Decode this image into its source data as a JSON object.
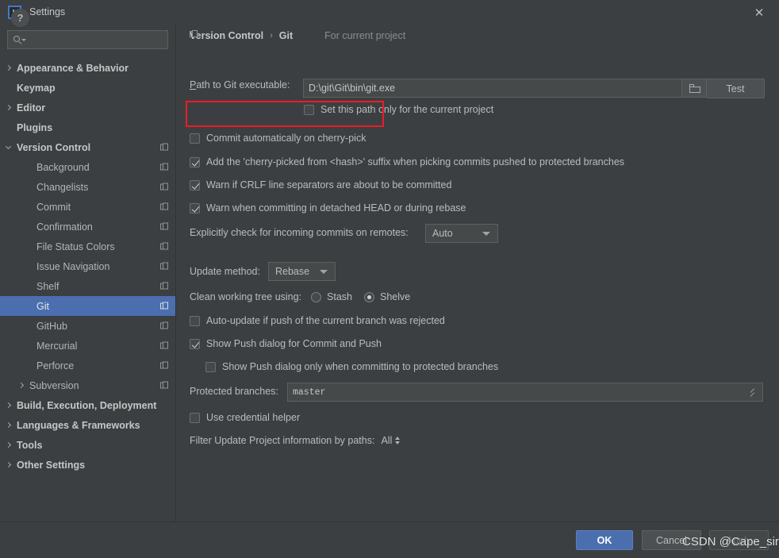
{
  "window": {
    "title": "Settings",
    "logo_text": "IJ",
    "close_label": "✕"
  },
  "sidebar": {
    "search": {
      "value": "",
      "placeholder": ""
    },
    "items": [
      {
        "label": "Appearance & Behavior",
        "indent": 0,
        "arrow": "right",
        "bold": true,
        "module_icon": false,
        "selected": false
      },
      {
        "label": "Keymap",
        "indent": 0,
        "arrow": "none",
        "bold": true,
        "module_icon": false,
        "selected": false
      },
      {
        "label": "Editor",
        "indent": 0,
        "arrow": "right",
        "bold": true,
        "module_icon": false,
        "selected": false
      },
      {
        "label": "Plugins",
        "indent": 0,
        "arrow": "none",
        "bold": true,
        "module_icon": false,
        "selected": false
      },
      {
        "label": "Version Control",
        "indent": 0,
        "arrow": "down",
        "bold": true,
        "module_icon": true,
        "selected": false
      },
      {
        "label": "Background",
        "indent": 1,
        "arrow": "none",
        "bold": false,
        "module_icon": true,
        "selected": false
      },
      {
        "label": "Changelists",
        "indent": 1,
        "arrow": "none",
        "bold": false,
        "module_icon": true,
        "selected": false
      },
      {
        "label": "Commit",
        "indent": 1,
        "arrow": "none",
        "bold": false,
        "module_icon": true,
        "selected": false
      },
      {
        "label": "Confirmation",
        "indent": 1,
        "arrow": "none",
        "bold": false,
        "module_icon": true,
        "selected": false
      },
      {
        "label": "File Status Colors",
        "indent": 1,
        "arrow": "none",
        "bold": false,
        "module_icon": true,
        "selected": false
      },
      {
        "label": "Issue Navigation",
        "indent": 1,
        "arrow": "none",
        "bold": false,
        "module_icon": true,
        "selected": false
      },
      {
        "label": "Shelf",
        "indent": 1,
        "arrow": "none",
        "bold": false,
        "module_icon": true,
        "selected": false
      },
      {
        "label": "Git",
        "indent": 1,
        "arrow": "none",
        "bold": false,
        "module_icon": true,
        "selected": true
      },
      {
        "label": "GitHub",
        "indent": 1,
        "arrow": "none",
        "bold": false,
        "module_icon": true,
        "selected": false
      },
      {
        "label": "Mercurial",
        "indent": 1,
        "arrow": "none",
        "bold": false,
        "module_icon": true,
        "selected": false
      },
      {
        "label": "Perforce",
        "indent": 1,
        "arrow": "none",
        "bold": false,
        "module_icon": true,
        "selected": false
      },
      {
        "label": "Subversion",
        "indent": 1,
        "arrow": "right",
        "bold": false,
        "module_icon": true,
        "selected": false
      },
      {
        "label": "Build, Execution, Deployment",
        "indent": 0,
        "arrow": "right",
        "bold": true,
        "module_icon": false,
        "selected": false
      },
      {
        "label": "Languages & Frameworks",
        "indent": 0,
        "arrow": "right",
        "bold": true,
        "module_icon": false,
        "selected": false
      },
      {
        "label": "Tools",
        "indent": 0,
        "arrow": "right",
        "bold": true,
        "module_icon": false,
        "selected": false
      },
      {
        "label": "Other Settings",
        "indent": 0,
        "arrow": "right",
        "bold": true,
        "module_icon": false,
        "selected": false
      }
    ]
  },
  "content": {
    "breadcrumb": {
      "parent": "Version Control",
      "separator": "›",
      "current": "Git",
      "note": "For current project"
    },
    "path_row": {
      "label": "Path to Git executable:",
      "value": "D:\\git\\Git\\bin\\git.exe",
      "test_button": "Test"
    },
    "checkboxes": {
      "set_path_only": {
        "label": "Set this path only for the current project",
        "checked": false
      },
      "commit_auto_cherry_pick": {
        "label": "Commit automatically on cherry-pick",
        "checked": false
      },
      "add_cherry_picked_suffix": {
        "label": "Add the 'cherry-picked from <hash>' suffix when picking commits pushed to protected branches",
        "checked": true
      },
      "warn_crlf": {
        "label": "Warn if CRLF line separators are about to be committed",
        "checked": true
      },
      "warn_detached_head": {
        "label": "Warn when committing in detached HEAD or during rebase",
        "checked": true
      },
      "auto_update_rejected": {
        "label": "Auto-update if push of the current branch was rejected",
        "checked": false
      },
      "show_push_dialog": {
        "label": "Show Push dialog for Commit and Push",
        "checked": true
      },
      "show_push_dialog_protected": {
        "label": "Show Push dialog only when committing to protected branches",
        "checked": false
      },
      "use_credential_helper": {
        "label": "Use credential helper",
        "checked": false
      }
    },
    "incoming_commits": {
      "label": "Explicitly check for incoming commits on remotes:",
      "value": "Auto"
    },
    "update_method": {
      "label": "Update method:",
      "value": "Rebase"
    },
    "clean_working_tree": {
      "label": "Clean working tree using:",
      "options": [
        "Stash",
        "Shelve"
      ],
      "selected": "Shelve"
    },
    "protected_branches": {
      "label": "Protected branches:",
      "value": "master"
    },
    "filter_paths": {
      "label": "Filter Update Project information by paths:",
      "value": "All"
    }
  },
  "footer": {
    "help": "?",
    "ok": "OK",
    "cancel": "Cancel",
    "apply": "Apply"
  },
  "watermark": {
    "text": "CSDN @Cape_sir"
  },
  "colors": {
    "background": "#3c3f41",
    "selection": "#4b6eaf",
    "highlight_box": "#ee1b24",
    "field_bg": "#45494a",
    "text": "#bbbbbb"
  }
}
